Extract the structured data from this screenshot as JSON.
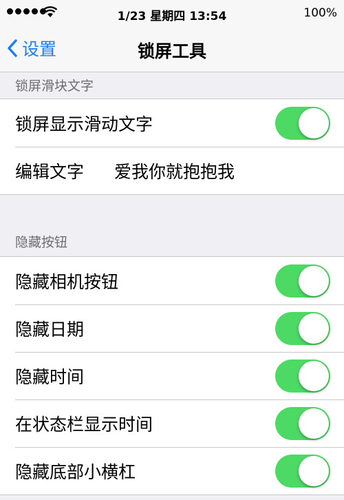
{
  "status_bar": {
    "time": "1/23 星期四 13:54",
    "battery": "100%"
  },
  "nav": {
    "back_label": "设置",
    "title": "锁屏工具"
  },
  "sections": [
    {
      "header": "锁屏滑块文字",
      "rows": [
        {
          "label": "锁屏显示滑动文字",
          "toggle": true
        },
        {
          "label": "编辑文字",
          "value": "爱我你就抱抱我"
        }
      ]
    },
    {
      "header": "隐藏按钮",
      "rows": [
        {
          "label": "隐藏相机按钮",
          "toggle": true
        },
        {
          "label": "隐藏日期",
          "toggle": true
        },
        {
          "label": "隐藏时间",
          "toggle": true
        },
        {
          "label": "在状态栏显示时间",
          "toggle": true
        },
        {
          "label": "隐藏底部小横杠",
          "toggle": true
        }
      ]
    }
  ],
  "colors": {
    "accent": "#1a7ef7",
    "toggle_on": "#4cd964",
    "background": "#efeff4"
  }
}
